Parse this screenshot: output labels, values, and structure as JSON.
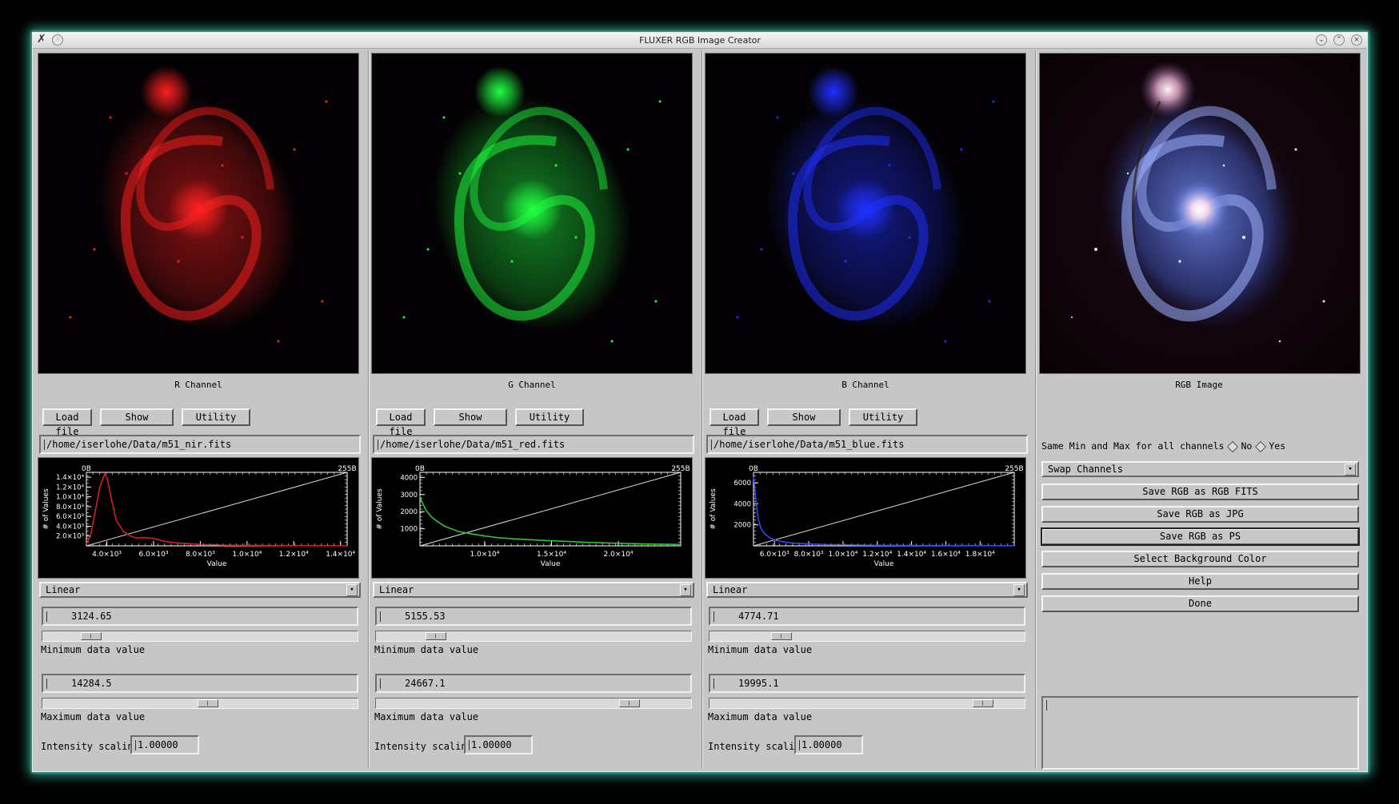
{
  "window": {
    "title": "FLUXER RGB Image Creator"
  },
  "channels": [
    {
      "id": "r",
      "caption": "R Channel",
      "buttons": {
        "load": "Load file",
        "show": "Show",
        "utility": "Utility"
      },
      "file_path": "/home/iserlohe/Data/m51_nir.fits",
      "scaling_mode": "Linear",
      "min_value": "3124.65",
      "max_value": "14284.5",
      "min_slider_fraction": 0.13,
      "max_slider_fraction": 0.53,
      "min_label": "Minimum data value",
      "max_label": "Maximum data value",
      "intensity_label": "Intensity scaling :",
      "intensity_value": "1.00000",
      "galaxy_color": "#ff2020"
    },
    {
      "id": "g",
      "caption": "G Channel",
      "buttons": {
        "load": "Load file",
        "show": "Show",
        "utility": "Utility"
      },
      "file_path": "/home/iserlohe/Data/m51_red.fits",
      "scaling_mode": "Linear",
      "min_value": "5155.53",
      "max_value": "24667.1",
      "min_slider_fraction": 0.17,
      "max_slider_fraction": 0.83,
      "min_label": "Minimum data value",
      "max_label": "Maximum data value",
      "intensity_label": "Intensity scaling :",
      "intensity_value": "1.00000",
      "galaxy_color": "#20ff40"
    },
    {
      "id": "b",
      "caption": "B Channel",
      "buttons": {
        "load": "Load file",
        "show": "Show",
        "utility": "Utility"
      },
      "file_path": "/home/iserlohe/Data/m51_blue.fits",
      "scaling_mode": "Linear",
      "min_value": "4774.71",
      "max_value": "19995.1",
      "min_slider_fraction": 0.21,
      "max_slider_fraction": 0.9,
      "min_label": "Minimum data value",
      "max_label": "Maximum data value",
      "intensity_label": "Intensity scaling:",
      "intensity_value": "1.00000",
      "galaxy_color": "#2030ff"
    }
  ],
  "rgb_panel": {
    "caption": "RGB Image",
    "same_minmax_label": "Same Min and Max for all channels",
    "option_no": "No",
    "option_yes": "Yes",
    "swap_channels": "Swap Channels",
    "buttons": [
      "Save RGB as RGB FITS",
      "Save RGB as JPG",
      "Save RGB as PS",
      "Select Background Color",
      "Help",
      "Done"
    ],
    "selected_button": "Save RGB as PS"
  },
  "chart_data": [
    {
      "type": "line",
      "channel": "R",
      "xlabel": "Value",
      "ylabel": "# of Values",
      "top_left_label": "0B",
      "top_right_label": "255B",
      "x_ticks": [
        "4.0×10³",
        "6.0×10³",
        "8.0×10³",
        "1.0×10⁴",
        "1.2×10⁴",
        "1.4×10⁴"
      ],
      "y_ticks": [
        "2.0×10³",
        "4.0×10³",
        "6.0×10³",
        "8.0×10³",
        "1.0×10⁴",
        "1.2×10⁴",
        "1.4×10⁴"
      ],
      "xlim": [
        3124.65,
        14284.5
      ],
      "ylim": [
        0,
        15000
      ],
      "series_color": "#e02020",
      "x": [
        3125,
        3300,
        3500,
        3700,
        3900,
        4000,
        4200,
        4400,
        4700,
        5000,
        5300,
        5600,
        6000,
        6500,
        7000,
        8000,
        9000,
        10000,
        12000,
        14284
      ],
      "y": [
        400,
        2000,
        7000,
        12000,
        14600,
        14000,
        9500,
        5200,
        3000,
        2000,
        1600,
        1700,
        1500,
        900,
        600,
        300,
        150,
        90,
        50,
        30
      ]
    },
    {
      "type": "line",
      "channel": "G",
      "xlabel": "Value",
      "ylabel": "# of Values",
      "top_left_label": "0B",
      "top_right_label": "255B",
      "x_ticks": [
        "1.0×10⁴",
        "1.5×10⁴",
        "2.0×10⁴"
      ],
      "y_ticks": [
        "1000",
        "2000",
        "3000",
        "4000"
      ],
      "xlim": [
        5155.53,
        24667.1
      ],
      "ylim": [
        0,
        4300
      ],
      "series_color": "#30d030",
      "x": [
        5156,
        5300,
        5600,
        6000,
        6500,
        7000,
        7500,
        8000,
        9000,
        10000,
        11000,
        12000,
        14000,
        16000,
        18000,
        20000,
        22000,
        24667
      ],
      "y": [
        2900,
        2600,
        2100,
        1700,
        1400,
        1150,
        1000,
        850,
        700,
        580,
        480,
        420,
        330,
        260,
        200,
        150,
        110,
        80
      ]
    },
    {
      "type": "line",
      "channel": "B",
      "xlabel": "Value",
      "ylabel": "# of Values",
      "top_left_label": "0B",
      "top_right_label": "255B",
      "x_ticks": [
        "6.0×10³",
        "8.0×10³",
        "1.0×10⁴",
        "1.2×10⁴",
        "1.4×10⁴",
        "1.6×10⁴",
        "1.8×10⁴"
      ],
      "y_ticks": [
        "2000",
        "4000",
        "6000"
      ],
      "xlim": [
        4774.71,
        19995.1
      ],
      "ylim": [
        0,
        7000
      ],
      "series_color": "#3050ff",
      "x": [
        4775,
        4850,
        4950,
        5050,
        5200,
        5400,
        5700,
        6000,
        6500,
        7000,
        8000,
        9000,
        10000,
        12000,
        14000,
        16000,
        18000,
        19995
      ],
      "y": [
        6600,
        5500,
        3800,
        2600,
        1700,
        1200,
        800,
        560,
        380,
        280,
        180,
        120,
        90,
        60,
        40,
        30,
        20,
        15
      ]
    }
  ]
}
